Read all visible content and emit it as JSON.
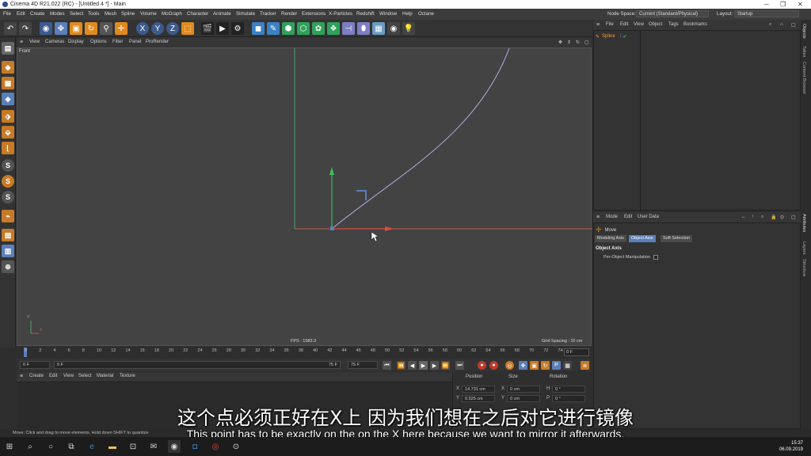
{
  "window": {
    "title": "Cinema 4D R21.022 (RC) - [Untitled 4 *] - Main"
  },
  "menubar": {
    "items": [
      "File",
      "Edit",
      "Create",
      "Modes",
      "Select",
      "Tools",
      "Mesh",
      "Spline",
      "Volume",
      "MoGraph",
      "Character",
      "Animate",
      "Simulate",
      "Tracker",
      "Render",
      "Extensions",
      "X-Particles",
      "Redshift",
      "Window",
      "Help",
      "Octane"
    ],
    "node_space_label": "Node Space:",
    "node_space_value": "Current (Standard/Physical)",
    "layout_label": "Layout:",
    "layout_value": "Startup"
  },
  "toolbar": {
    "axis_x": "X",
    "axis_y": "Y",
    "axis_z": "Z"
  },
  "viewport": {
    "menu": [
      "View",
      "Cameras",
      "Display",
      "Options",
      "Filter",
      "Panel",
      "ProRender"
    ],
    "label": "Front",
    "fps": "FPS : 1583.3",
    "grid_spacing": "Grid Spacing : 10 cm",
    "axis_x": "X",
    "axis_y": "Y"
  },
  "timeline": {
    "ticks": [
      "0",
      "2",
      "4",
      "6",
      "8",
      "10",
      "12",
      "14",
      "16",
      "18",
      "20",
      "22",
      "24",
      "26",
      "28",
      "30",
      "32",
      "34",
      "36",
      "38",
      "40",
      "42",
      "44",
      "46",
      "48",
      "50",
      "52",
      "54",
      "56",
      "58",
      "60",
      "62",
      "64",
      "66",
      "68",
      "70",
      "72",
      "74"
    ],
    "current_frame": "0 F",
    "start": "0 F",
    "min": "0 F",
    "max": "75 F",
    "end": "75 F"
  },
  "material": {
    "menu": [
      "Create",
      "Edit",
      "View",
      "Select",
      "Material",
      "Texture"
    ]
  },
  "coordinates": {
    "headers": [
      "Position",
      "Size",
      "Rotation"
    ],
    "rows": [
      {
        "axis": "X",
        "pos": "14.731 cm",
        "size_axis": "X",
        "size": "0 cm",
        "rot_axis": "H",
        "rot": "0 °"
      },
      {
        "axis": "Y",
        "pos": "0.525 cm",
        "size_axis": "Y",
        "size": "0 cm",
        "rot_axis": "P",
        "rot": "0 °"
      }
    ]
  },
  "objects": {
    "menu": [
      "File",
      "Edit",
      "View",
      "Object",
      "Tags",
      "Bookmarks"
    ],
    "items": [
      {
        "name": "Spline"
      }
    ]
  },
  "attributes": {
    "menu": [
      "Mode",
      "Edit",
      "User Data"
    ],
    "tool": "Move",
    "tabs": [
      "Modeling Axis",
      "Object Axis",
      "Soft Selection"
    ],
    "active_tab": "Object Axis",
    "section": "Object Axis",
    "option": "Per-Object Manipulation"
  },
  "right_tabs": [
    "Objects",
    "Takes",
    "Content Browser",
    "Attributes",
    "Layers",
    "Structure"
  ],
  "status": "Move: Click and drag to move elements. Hold down SHIFT to quantize",
  "subtitles": {
    "cn": "这个点必须正好在X上 因为我们想在之后对它进行镜像",
    "en": "This point has to be exactly on the on the X here because we want to mirror it afterwards."
  },
  "taskbar": {
    "time": "15:37",
    "date": "06.09.2019"
  },
  "colors": {
    "accent": "#5b7fb8",
    "spline": "#ff9c2a",
    "axis_x": "#e04a3a",
    "axis_y": "#3fbf5a"
  }
}
